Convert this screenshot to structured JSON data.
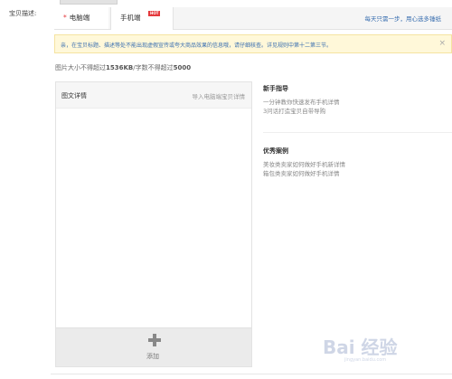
{
  "field": {
    "label": "宝贝描述:"
  },
  "tabs": [
    {
      "label": "电脑端",
      "required_mark": "*"
    },
    {
      "label": "手机端",
      "badge": "HOT"
    }
  ],
  "tab_link": "每天只需一步，用心选多锤纸",
  "notice": {
    "text": "亲，在宝贝标题、描述等处不能出现虚假宣传或夸大商品效果的信息哦，请仔细核查。详见规则中第十二第三节。",
    "close": "×"
  },
  "limit": {
    "prefix": "图片大小不得超过",
    "size": "1536KB",
    "mid": "/字数不得超过",
    "chars": "5000"
  },
  "editor": {
    "title": "图文详情",
    "import_label": "导入电脑端宝贝详情",
    "add_label": "添加"
  },
  "guide": {
    "title": "新手指导",
    "lines": [
      "一分钟教你快速发布手机详情",
      "3问话打造宝贝自带导购"
    ]
  },
  "cases": {
    "title": "优秀案例",
    "lines": [
      "美妆类卖家如何做好手机新详情",
      "箱包类卖家如何做好手机详情"
    ]
  },
  "watermark": {
    "main": "Bai 经验",
    "sub": "jingyan.baidu.com"
  },
  "colors": {
    "link": "#3a6fb0",
    "notice_bg": "#fff8d9",
    "hot": "#e4393c"
  }
}
